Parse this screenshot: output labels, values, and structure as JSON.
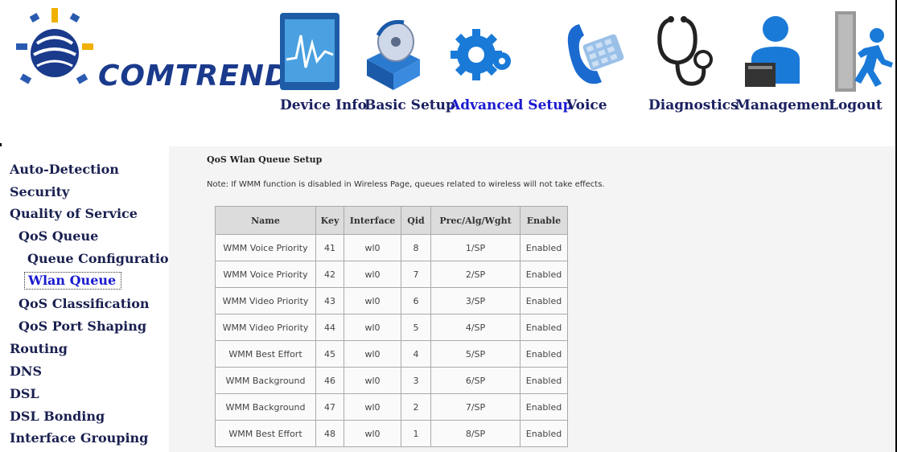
{
  "brand": {
    "name": "COMTREND"
  },
  "nav": [
    {
      "label": "Device Info",
      "icon": "device-info-icon",
      "active": false
    },
    {
      "label": "Basic Setup",
      "icon": "basic-setup-icon",
      "active": false
    },
    {
      "label": "Advanced Setup",
      "icon": "advanced-setup-icon",
      "active": true
    },
    {
      "label": "Voice",
      "icon": "voice-icon",
      "active": false
    },
    {
      "label": "Diagnostics",
      "icon": "diagnostics-icon",
      "active": false
    },
    {
      "label": "Management",
      "icon": "management-icon",
      "active": false
    },
    {
      "label": "Logout",
      "icon": "logout-icon",
      "active": false
    }
  ],
  "sidebar": {
    "items": [
      {
        "label": "Auto-Detection",
        "level": 0
      },
      {
        "label": "Security",
        "level": 0
      },
      {
        "label": "Quality of Service",
        "level": 0
      },
      {
        "label": "QoS Queue",
        "level": 1
      },
      {
        "label": "Queue Configuration",
        "level": 2
      },
      {
        "label": "Wlan Queue",
        "level": 2,
        "selected": true
      },
      {
        "label": "QoS Classification",
        "level": 1
      },
      {
        "label": "QoS Port Shaping",
        "level": 1
      },
      {
        "label": "Routing",
        "level": 0
      },
      {
        "label": "DNS",
        "level": 0
      },
      {
        "label": "DSL",
        "level": 0
      },
      {
        "label": "DSL Bonding",
        "level": 0
      },
      {
        "label": "Interface Grouping",
        "level": 0
      }
    ]
  },
  "main": {
    "title": "QoS Wlan Queue Setup",
    "note": "Note: If WMM function is disabled in Wireless Page, queues related to wireless will not take effects.",
    "table": {
      "headers": [
        "Name",
        "Key",
        "Interface",
        "Qid",
        "Prec/Alg/Wght",
        "Enable"
      ],
      "rows": [
        [
          "WMM Voice Priority",
          "41",
          "wl0",
          "8",
          "1/SP",
          "Enabled"
        ],
        [
          "WMM Voice Priority",
          "42",
          "wl0",
          "7",
          "2/SP",
          "Enabled"
        ],
        [
          "WMM Video Priority",
          "43",
          "wl0",
          "6",
          "3/SP",
          "Enabled"
        ],
        [
          "WMM Video Priority",
          "44",
          "wl0",
          "5",
          "4/SP",
          "Enabled"
        ],
        [
          "WMM Best Effort",
          "45",
          "wl0",
          "4",
          "5/SP",
          "Enabled"
        ],
        [
          "WMM Background",
          "46",
          "wl0",
          "3",
          "6/SP",
          "Enabled"
        ],
        [
          "WMM Background",
          "47",
          "wl0",
          "2",
          "7/SP",
          "Enabled"
        ],
        [
          "WMM Best Effort",
          "48",
          "wl0",
          "1",
          "8/SP",
          "Enabled"
        ]
      ]
    }
  },
  "colors": {
    "brand": "#1a3a8c",
    "active_link": "#1a1ad0",
    "nav_text": "#1a2060"
  }
}
